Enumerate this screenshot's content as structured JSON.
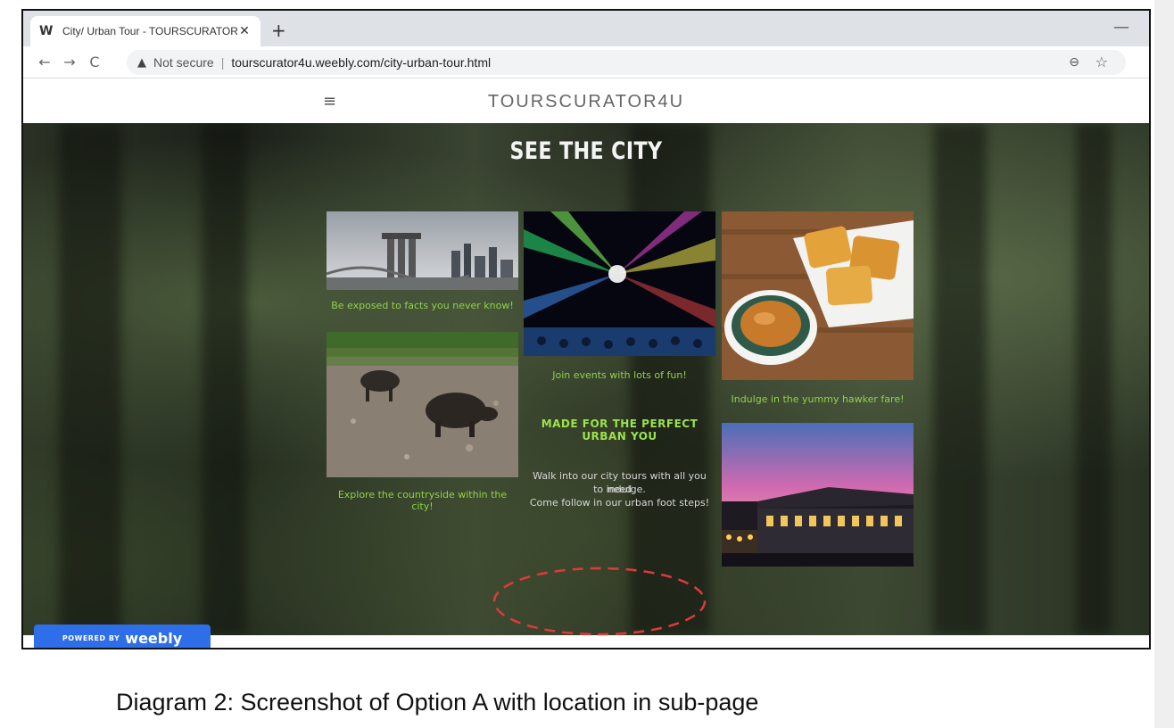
{
  "browser": {
    "tab_title": "City/ Urban Tour - TOURSCURATOR",
    "tab_close": "✕",
    "new_tab": "+",
    "minimize": "—",
    "security_label": "Not secure",
    "separator": "|",
    "url": "tourscurator4u.weebly.com/city-urban-tour.html",
    "icons": [
      "weebly-favicon-icon",
      "back-icon",
      "forward-icon",
      "reload-icon",
      "warning-icon",
      "zoom-icon",
      "bookmark-star-icon"
    ]
  },
  "site": {
    "title": "TOURSCURATOR4U",
    "menu_icon": "hamburger-menu-icon"
  },
  "hero": {
    "title": "SEE THE CITY"
  },
  "gallery": {
    "caption_facts": "Be exposed to facts you never know!",
    "caption_countryside": "Explore the countryside within the city!",
    "caption_events": "Join events with lots of fun!",
    "caption_hawker": "Indulge in the yummy hawker fare!",
    "heading": "MADE FOR THE PERFECT URBAN YOU",
    "body_line1": "Walk into our city tours with all you need",
    "body_line2": "to indulge.",
    "body_line3": "Come follow in our urban foot steps!"
  },
  "badge": {
    "powered": "POWERED BY",
    "brand": "weebly"
  },
  "colors": {
    "caption_green": "#8fd24a",
    "badge_blue": "#2e6ee8",
    "marker_red": "#e03a3a"
  },
  "figure_caption": "Diagram 2: Screenshot of Option A with location in sub-page"
}
